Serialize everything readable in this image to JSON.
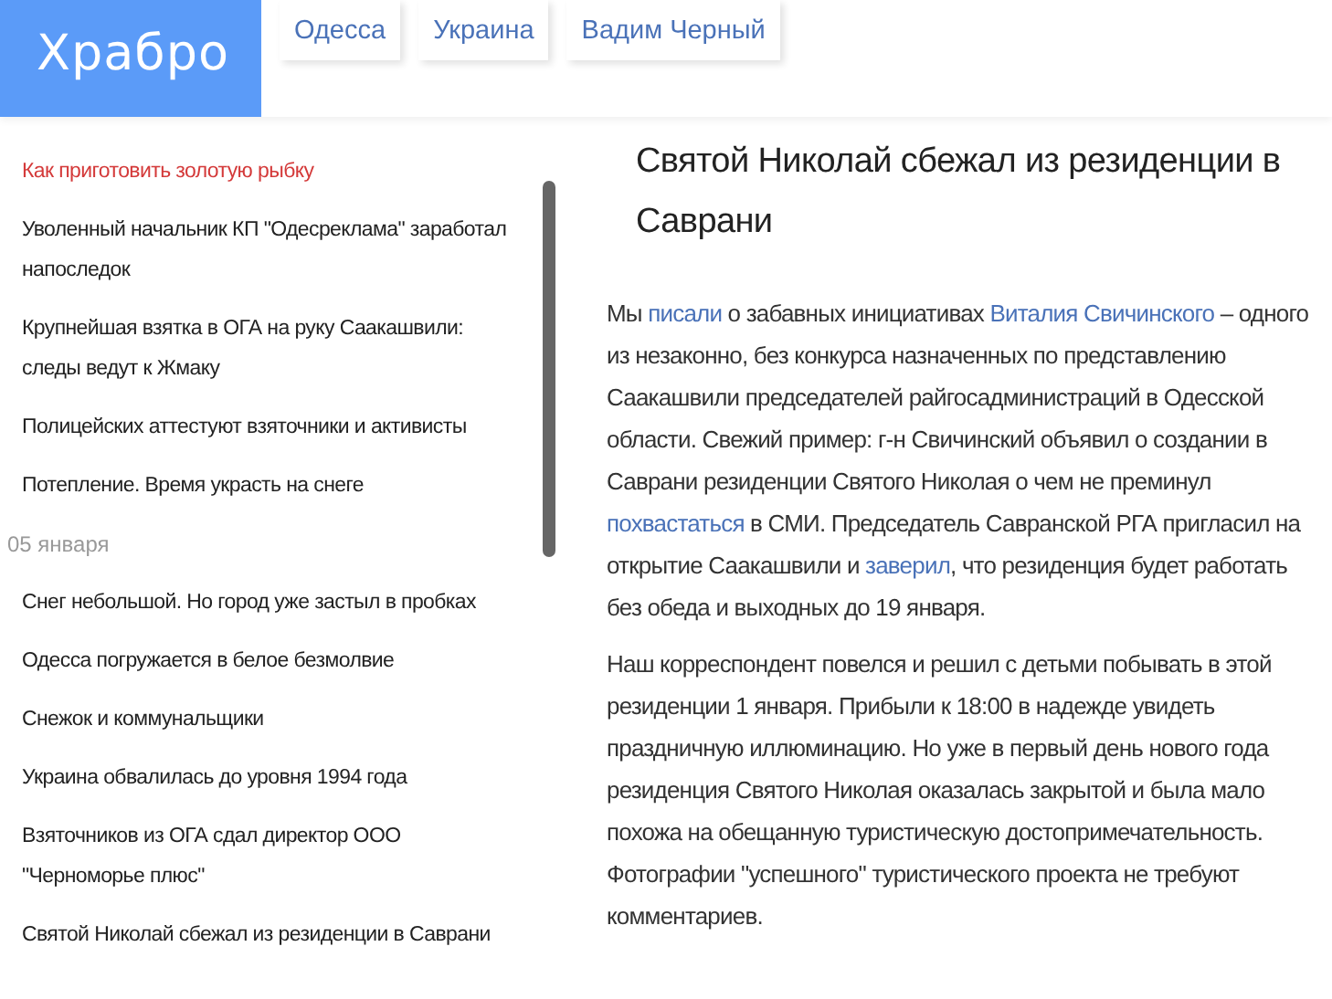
{
  "logo": "Храбро",
  "nav": [
    {
      "label": "Одесса"
    },
    {
      "label": "Украина"
    },
    {
      "label": "Вадим Черный"
    }
  ],
  "sidebar": {
    "items": [
      {
        "kind": "link",
        "text": "Как приготовить золотую рыбку",
        "selected": true
      },
      {
        "kind": "link",
        "text": "Уволенный начальник КП \"Одесреклама\" заработал напоследок",
        "selected": false
      },
      {
        "kind": "link",
        "text": "Крупнейшая взятка в ОГА на руку Саакашвили: следы ведут к Жмаку",
        "selected": false
      },
      {
        "kind": "link",
        "text": "Полицейских аттестуют взяточники и активисты",
        "selected": false
      },
      {
        "kind": "link",
        "text": "Потепление. Время украсть на снеге",
        "selected": false
      },
      {
        "kind": "date",
        "text": "05 января"
      },
      {
        "kind": "link",
        "text": "Снег небольшой. Но город уже застыл в пробках",
        "selected": false
      },
      {
        "kind": "link",
        "text": "Одесса погружается в белое безмолвие",
        "selected": false
      },
      {
        "kind": "link",
        "text": "Снежок и коммунальщики",
        "selected": false
      },
      {
        "kind": "link",
        "text": "Украина обвалилась до уровня 1994 года",
        "selected": false
      },
      {
        "kind": "link",
        "text": "Взяточников из ОГА сдал директор ООО \"Черноморье плюс\"",
        "selected": false
      },
      {
        "kind": "link",
        "text": "Святой Николай сбежал из резиденции в Саврани",
        "selected": false
      }
    ]
  },
  "article": {
    "title": "Святой Николай сбежал из резиденции в Саврани",
    "paragraphs": [
      [
        {
          "kind": "text",
          "text": "Мы "
        },
        {
          "kind": "link",
          "text": "писали"
        },
        {
          "kind": "text",
          "text": " о забавных инициативах "
        },
        {
          "kind": "link",
          "text": "Виталия Свичинского"
        },
        {
          "kind": "text",
          "text": " – одного из незаконно, без конкурса назначенных по представлению Саакашвили председателей райгосадминистраций в Одесской области. Свежий пример: г-н Свичинский объявил о создании в Саврани резиденции Святого Николая о чем не преминул "
        },
        {
          "kind": "link",
          "text": "похвастаться"
        },
        {
          "kind": "text",
          "text": " в СМИ. Председатель Савранской РГА пригласил на открытие Саакашвили и "
        },
        {
          "kind": "link",
          "text": "заверил"
        },
        {
          "kind": "text",
          "text": ", что резиденция будет работать без обеда и выходных до 19 января."
        }
      ],
      [
        {
          "kind": "text",
          "text": "Наш корреспондент повелся и решил с детьми побывать в этой резиденции 1 января. Прибыли к 18:00 в надежде увидеть праздничную иллюминацию. Но уже в первый день нового года резиденция Святого Николая оказалась закрытой и была мало похожа на обещанную туристическую достопримечательность. Фотографии \"успешного\" туристического проекта не требуют комментариев."
        }
      ]
    ]
  }
}
